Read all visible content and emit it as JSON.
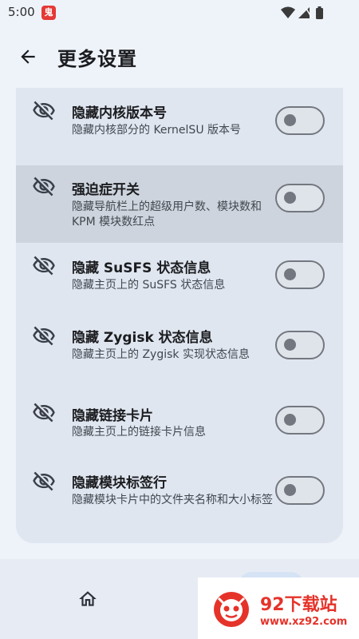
{
  "status_bar": {
    "time": "5:00",
    "app_icon": "notification-app-icon"
  },
  "header": {
    "title": "更多设置",
    "back_icon": "arrow-left-icon"
  },
  "settings": [
    {
      "title": "隐藏内核版本号",
      "description": "隐藏内核部分的 KernelSU 版本号",
      "icon": "eye-off-icon",
      "enabled": false
    },
    {
      "title": "强迫症开关",
      "description": "隐藏导航栏上的超级用户数、模块数和 KPM 模块数红点",
      "icon": "eye-off-icon",
      "enabled": false
    },
    {
      "title": "隐藏 SuSFS 状态信息",
      "description": "隐藏主页上的 SuSFS 状态信息",
      "icon": "eye-off-icon",
      "enabled": false
    },
    {
      "title": "隐藏 Zygisk 状态信息",
      "description": "隐藏主页上的 Zygisk 实现状态信息",
      "icon": "eye-off-icon",
      "enabled": false
    },
    {
      "title": "隐藏链接卡片",
      "description": "隐藏主页上的链接卡片信息",
      "icon": "eye-off-icon",
      "enabled": false
    },
    {
      "title": "隐藏模块标签行",
      "description": "隐藏模块卡片中的文件夹名称和大小标签",
      "icon": "eye-off-icon",
      "enabled": false
    }
  ],
  "bottom_nav": {
    "home_icon": "home-icon"
  },
  "watermark": {
    "title": "92下载站",
    "url": "www.xz92.com"
  }
}
